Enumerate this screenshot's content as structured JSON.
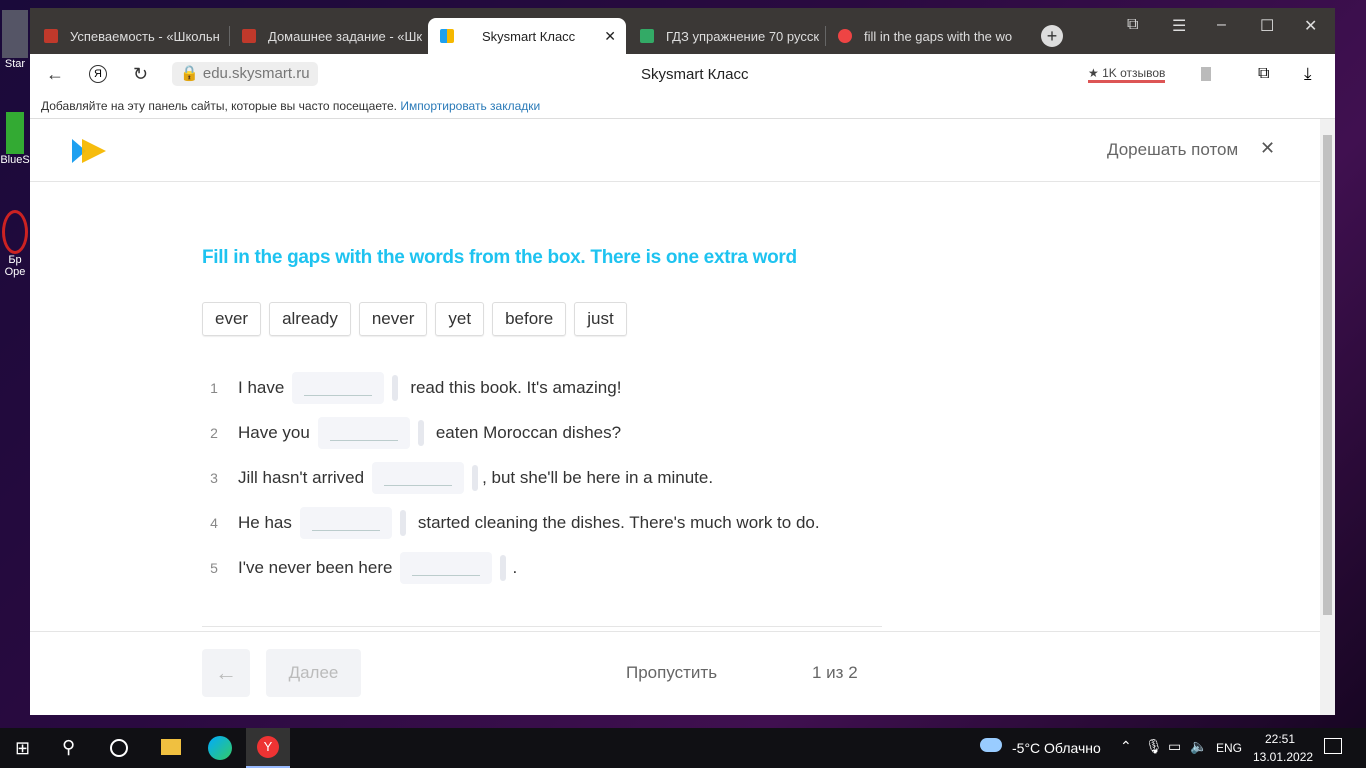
{
  "desktop": {
    "icons": [
      "Star",
      "BlueS",
      "Бр Оре"
    ]
  },
  "browser": {
    "tabs": [
      {
        "label": "Успеваемость - «Школьн",
        "color": "#c0392b"
      },
      {
        "label": "Домашнее задание - «Шк",
        "color": "#c0392b"
      },
      {
        "label": "Skysmart Класс",
        "color": "#f5b800",
        "active": true
      },
      {
        "label": "ГДЗ упражнение 70 русск",
        "color": "#3a6"
      },
      {
        "label": "fill in the gaps with the wo",
        "color": "#e44"
      }
    ],
    "url": "edu.skysmart.ru",
    "page_title": "Skysmart Класс",
    "reviews": "★ 1K отзывов",
    "bookmarks_bar": {
      "text": "Добавляйте на эту панель сайты, которые вы часто посещаете.",
      "link": "Импортировать закладки"
    }
  },
  "header": {
    "later": "Дорешать потом"
  },
  "task": {
    "title": "Fill in the gaps with the words from the box. There is one extra word",
    "words": [
      "ever",
      "already",
      "never",
      "yet",
      "before",
      "just"
    ],
    "questions": [
      {
        "n": "1",
        "before": "I have",
        "after": "read this book. It's amazing!"
      },
      {
        "n": "2",
        "before": "Have you",
        "after": "eaten Moroccan dishes?"
      },
      {
        "n": "3",
        "before": "Jill hasn't arrived",
        "after": ", but she'll be here in a minute."
      },
      {
        "n": "4",
        "before": "He has",
        "after": "started cleaning the dishes. There's much work to do."
      },
      {
        "n": "5",
        "before": "I've never been here",
        "after": "."
      }
    ]
  },
  "footer": {
    "next": "Далее",
    "skip": "Пропустить",
    "progress": "1 из 2"
  },
  "taskbar": {
    "weather": "-5°C  Облачно",
    "lang": "ENG",
    "time": "22:51",
    "date": "13.01.2022"
  }
}
